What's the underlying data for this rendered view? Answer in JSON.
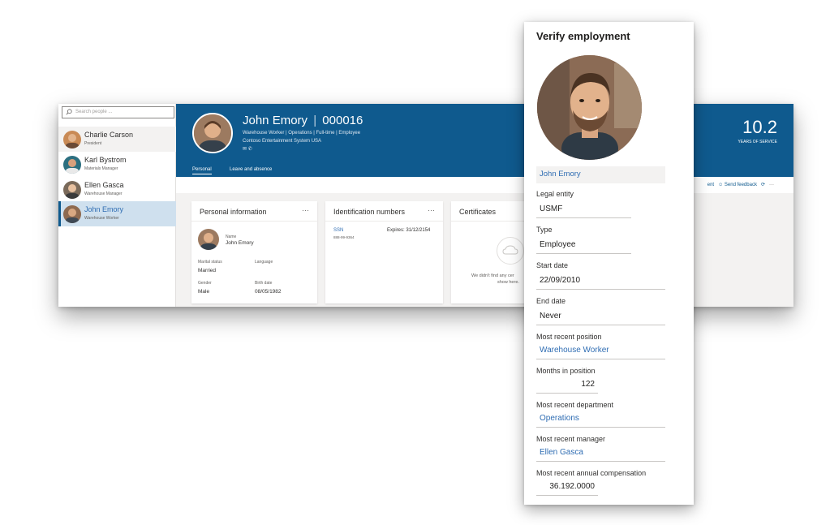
{
  "app": {
    "search_placeholder": "Search people ...",
    "people": [
      {
        "name": "Charlie Carson",
        "role": "President"
      },
      {
        "name": "Karl Bystrom",
        "role": "Materials Manager"
      },
      {
        "name": "Ellen Gasca",
        "role": "Warehouse Manager"
      },
      {
        "name": "John Emory",
        "role": "Warehouse Worker"
      }
    ],
    "header": {
      "name": "John Emory",
      "separator": "|",
      "id": "000016",
      "meta": "Warehouse Worker  |  Operations  |  Full-time  |  Employee",
      "org": "Contoso Entertainment System USA",
      "icons": "✉  ✆",
      "tabs": [
        "Personal",
        "Leave and absence"
      ],
      "years_value": "10.2",
      "years_label": "YEARS OF SERVICE"
    },
    "toolbar": {
      "partial": "ent",
      "feedback": "Send feedback",
      "refresh": "⟳",
      "more": "···"
    },
    "cards": {
      "personal": {
        "title": "Personal information",
        "more": "···",
        "name_label": "Name",
        "name_value": "John Emory",
        "marital_label": "Marital status",
        "marital_value": "Married",
        "language_label": "Language",
        "gender_label": "Gender",
        "gender_value": "Male",
        "birth_label": "Birth date",
        "birth_value": "08/05/1982"
      },
      "ident": {
        "title": "Identification numbers",
        "more": "···",
        "ssn_label": "SSN",
        "ssn_value": "888-99-9364",
        "expires": "Expires: 31/12/2154"
      },
      "cert": {
        "title": "Certificates",
        "empty_line1": "We didn't find any cer",
        "empty_line2": "show here."
      }
    }
  },
  "panel": {
    "title": "Verify employment",
    "employee_name": "John Emory",
    "fields": [
      {
        "label": "Legal entity",
        "value": "USMF"
      },
      {
        "label": "Type",
        "value": "Employee"
      },
      {
        "label": "Start date",
        "value": "22/09/2010"
      },
      {
        "label": "End date",
        "value": "Never"
      },
      {
        "label": "Most recent position",
        "value": "Warehouse Worker"
      },
      {
        "label": "Months in position",
        "value": "122"
      },
      {
        "label": "Most recent department",
        "value": "Operations"
      },
      {
        "label": "Most recent manager",
        "value": "Ellen Gasca"
      },
      {
        "label": "Most recent annual compensation",
        "value": "36.192.0000"
      }
    ]
  }
}
